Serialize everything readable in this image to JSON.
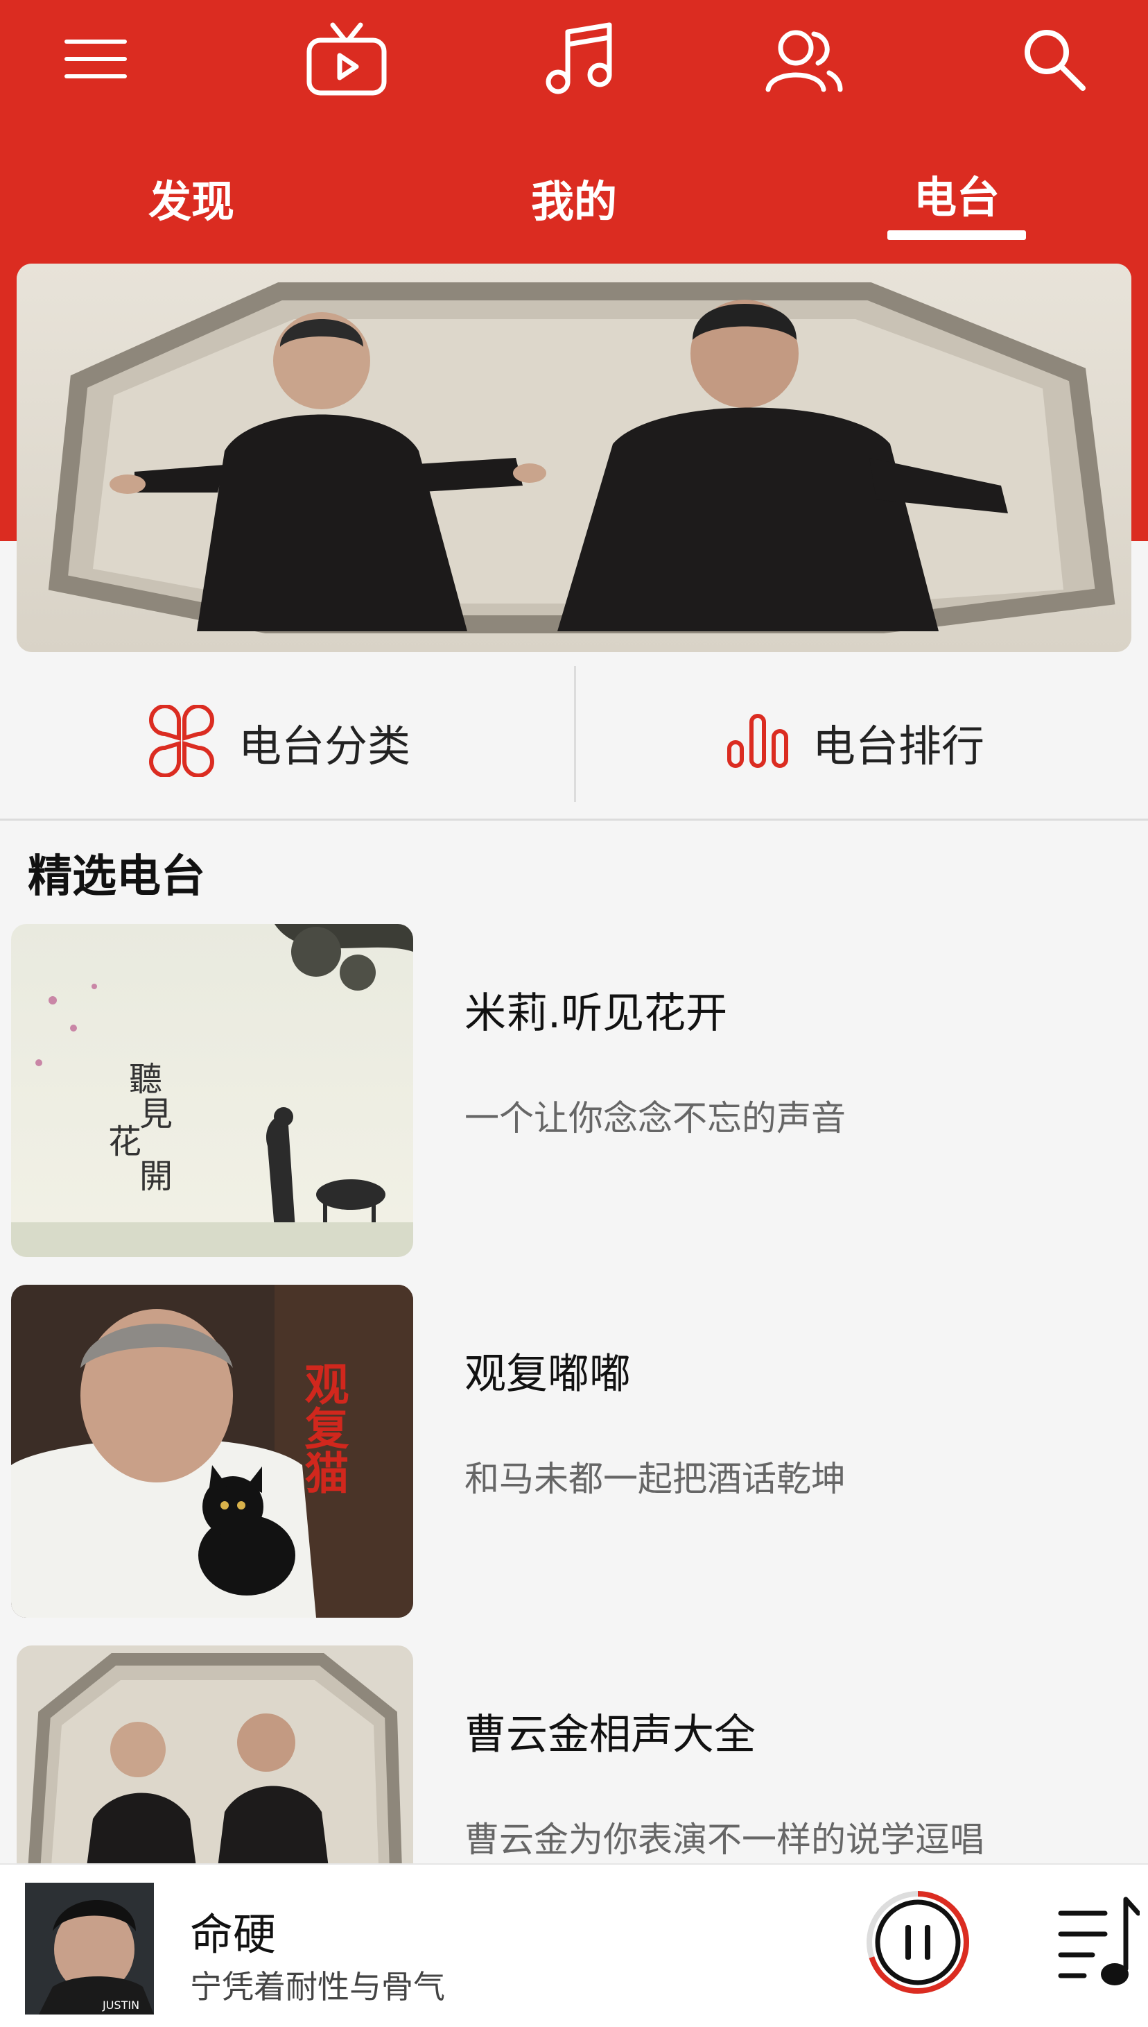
{
  "top_nav": {
    "icons": [
      "menu-icon",
      "video-icon",
      "music-icon",
      "friends-icon",
      "search-icon"
    ]
  },
  "tabs": [
    {
      "label": "发现"
    },
    {
      "label": "我的"
    },
    {
      "label": "电台",
      "active": true
    }
  ],
  "quick_links": {
    "category": {
      "label": "电台分类",
      "icon": "category-icon"
    },
    "ranking": {
      "label": "电台排行",
      "icon": "ranking-icon"
    }
  },
  "section": {
    "title": "精选电台"
  },
  "radios": [
    {
      "title": "米莉.听见花开",
      "desc": "一个让你念念不忘的声音",
      "cover_text": [
        "聽",
        "見",
        "花",
        "開"
      ]
    },
    {
      "title": "观复嘟嘟",
      "desc": "和马未都一起把酒话乾坤",
      "cover_text": "观复猫"
    },
    {
      "title": "曹云金相声大全",
      "desc": "曹云金为你表演不一样的说学逗唱"
    }
  ],
  "player": {
    "title": "命硬",
    "subtitle": "宁凭着耐性与骨气",
    "progress": 0.7,
    "cover_text": "JUSTIN"
  },
  "colors": {
    "brand": "#db2c21",
    "background": "#f5f5f5"
  }
}
